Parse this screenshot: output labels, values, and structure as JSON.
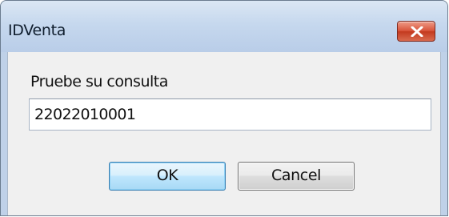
{
  "window": {
    "title": "IDVenta",
    "close_icon": "close-icon"
  },
  "dialog": {
    "prompt": "Pruebe su consulta",
    "input_value": "22022010001"
  },
  "buttons": {
    "ok_label": "OK",
    "cancel_label": "Cancel"
  },
  "colors": {
    "close_button": "#c9452a",
    "ok_button_border": "#3c7fb1",
    "dialog_background": "#f0f0f0"
  }
}
